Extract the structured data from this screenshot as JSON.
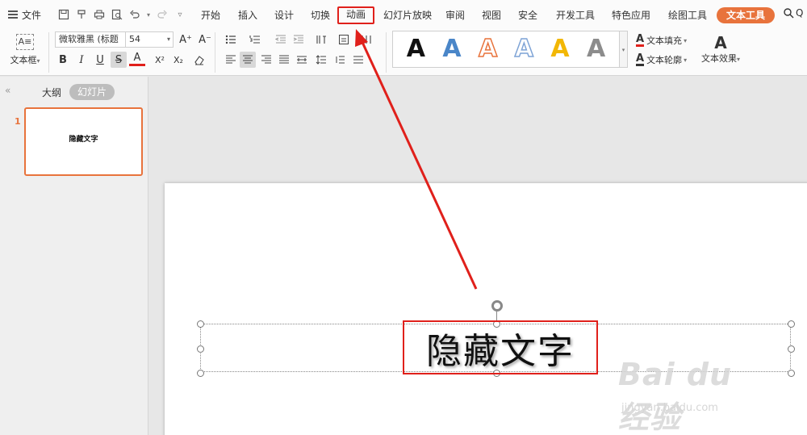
{
  "menu": {
    "file_label": "文件",
    "tabs": [
      "开始",
      "插入",
      "设计",
      "切换",
      "动画",
      "幻灯片放映",
      "审阅",
      "视图",
      "安全",
      "开发工具",
      "特色应用",
      "绘图工具",
      "文本工具"
    ],
    "highlighted_tab": "动画",
    "active_tab": "文本工具",
    "search_label": "Q"
  },
  "toolbar": {
    "textbox_label": "文本框",
    "font_name": "微软雅黑 (标题",
    "font_size": "54",
    "grow_font": "A⁺",
    "shrink_font": "A⁻",
    "bold": "B",
    "italic": "I",
    "underline": "U",
    "strike": "S",
    "font_color": "A",
    "superscript": "X²",
    "subscript": "X₂",
    "text_fill_label": "文本填充",
    "text_outline_label": "文本轮廓",
    "text_effects_label": "文本效果",
    "styles": [
      {
        "glyph": "A",
        "color": "#111111"
      },
      {
        "glyph": "A",
        "color": "#4a86c8"
      },
      {
        "glyph": "A",
        "color": "#e8733c"
      },
      {
        "glyph": "A",
        "color": "#7fa4d6"
      },
      {
        "glyph": "A",
        "color": "#f2b705"
      },
      {
        "glyph": "A",
        "color": "#8c8c8c"
      }
    ]
  },
  "panel": {
    "outline_tab": "大纲",
    "slides_tab": "幻灯片",
    "slide_number": "1",
    "thumb_text": "隐藏文字"
  },
  "slide": {
    "text": "隐藏文字"
  },
  "watermark": {
    "brand": "Bai du 经验",
    "url": "jingyan.baidu.com"
  },
  "colors": {
    "accent": "#e8733c",
    "highlight_red": "#e0201b"
  }
}
